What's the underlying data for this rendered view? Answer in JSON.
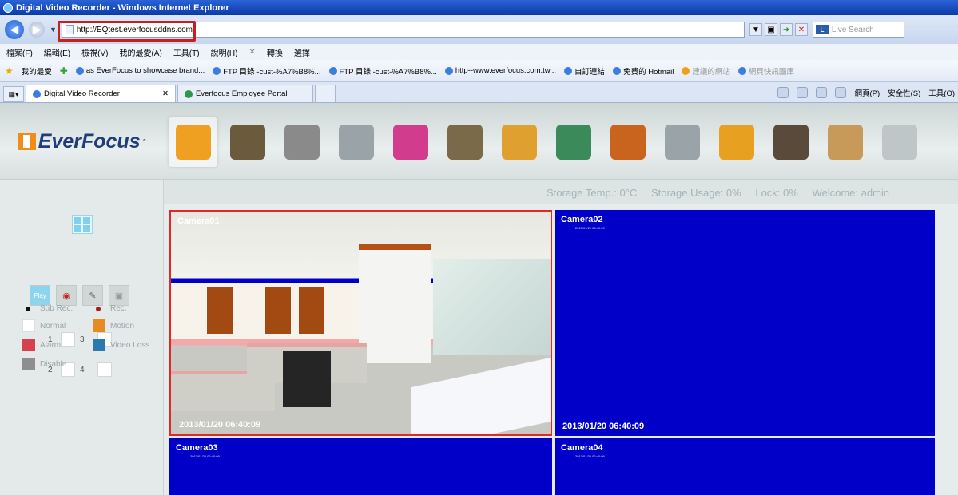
{
  "browser": {
    "window_title": "Digital Video Recorder - Windows Internet Explorer",
    "address": "http://EQtest.everfocusddns.com",
    "live_search_placeholder": "Live Search",
    "menu": [
      "檔案(F)",
      "編輯(E)",
      "檢視(V)",
      "我的最愛(A)",
      "工具(T)",
      "說明(H)",
      "轉換",
      "選擇"
    ],
    "favorites_label": "我的最愛",
    "favorites": [
      "as EverFocus to showcase brand...",
      "FTP 目錄 -cust-%A7%B8%...",
      "FTP 目錄 -cust-%A7%B8%...",
      "http--www.everfocus.com.tw...",
      "自訂連結",
      "免費的 Hotmail",
      "建議的網站",
      "網頁快訊圖庫"
    ],
    "tabs": [
      {
        "label": "Digital Video Recorder",
        "active": true
      },
      {
        "label": "Everfocus Employee Portal",
        "active": false
      }
    ],
    "command_bar": [
      "網頁(P)",
      "安全性(S)",
      "工具(O)"
    ]
  },
  "app": {
    "logo_text": "EverFocus",
    "status": {
      "storage_temp": "Storage Temp.: 0°C",
      "storage_usage": "Storage Usage: 0%",
      "lock": "Lock: 0%",
      "welcome": "Welcome: admin"
    },
    "toolbar_icons": [
      {
        "name": "live-view-icon",
        "color": "#f0a020"
      },
      {
        "name": "magic-wizard-icon",
        "color": "#6b5a3c"
      },
      {
        "name": "camera-icon",
        "color": "#8a8a8a"
      },
      {
        "name": "playback-reel-icon",
        "color": "#9aa3a8"
      },
      {
        "name": "alarm-icon",
        "color": "#d23c8c"
      },
      {
        "name": "disk-icon",
        "color": "#7a6a4a"
      },
      {
        "name": "display-icon",
        "color": "#e0a030"
      },
      {
        "name": "network-icon",
        "color": "#3a8a5a"
      },
      {
        "name": "schedule-icon",
        "color": "#c8641e"
      },
      {
        "name": "settings-gear-icon",
        "color": "#9aa3a8"
      },
      {
        "name": "info-icon",
        "color": "#e8a020"
      },
      {
        "name": "film-strip-icon",
        "color": "#5a4a3a"
      },
      {
        "name": "search-folder-icon",
        "color": "#c89a5a"
      },
      {
        "name": "ptz-dome-icon",
        "color": "#bfc6c8"
      }
    ],
    "sidebar": {
      "mode_buttons": [
        "Play"
      ],
      "channels": [
        "1",
        "3",
        "2",
        "4"
      ],
      "legend": {
        "sub_rec": "Sub Rec.",
        "rec": "Rec.",
        "normal": "Normal",
        "motion": "Motion",
        "alarm": "Alarm",
        "video_loss": "Video Loss",
        "disable": "Disable"
      },
      "legend_colors": {
        "normal": "#ffffff",
        "motion": "#e88a22",
        "alarm": "#d6424f",
        "video_loss": "#2a7ab0",
        "disable": "#8e8e8e"
      }
    },
    "cameras": [
      {
        "name": "Camera01",
        "timestamp": "2013/01/20  06:40:09",
        "sub": "2013/01/20 06:40:09",
        "selected": true
      },
      {
        "name": "Camera02",
        "timestamp": "2013/01/20  06:40:09",
        "sub": "2013/01/20 06:40:09",
        "selected": false
      },
      {
        "name": "Camera03",
        "timestamp": "",
        "sub": "2013/01/20 06:40:09",
        "selected": false
      },
      {
        "name": "Camera04",
        "timestamp": "",
        "sub": "2013/01/20 06:40:09",
        "selected": false
      }
    ],
    "colors": {
      "video_blue": "#0000c8",
      "selected_border": "#e02828",
      "url_highlight": "#c81e1e"
    }
  }
}
